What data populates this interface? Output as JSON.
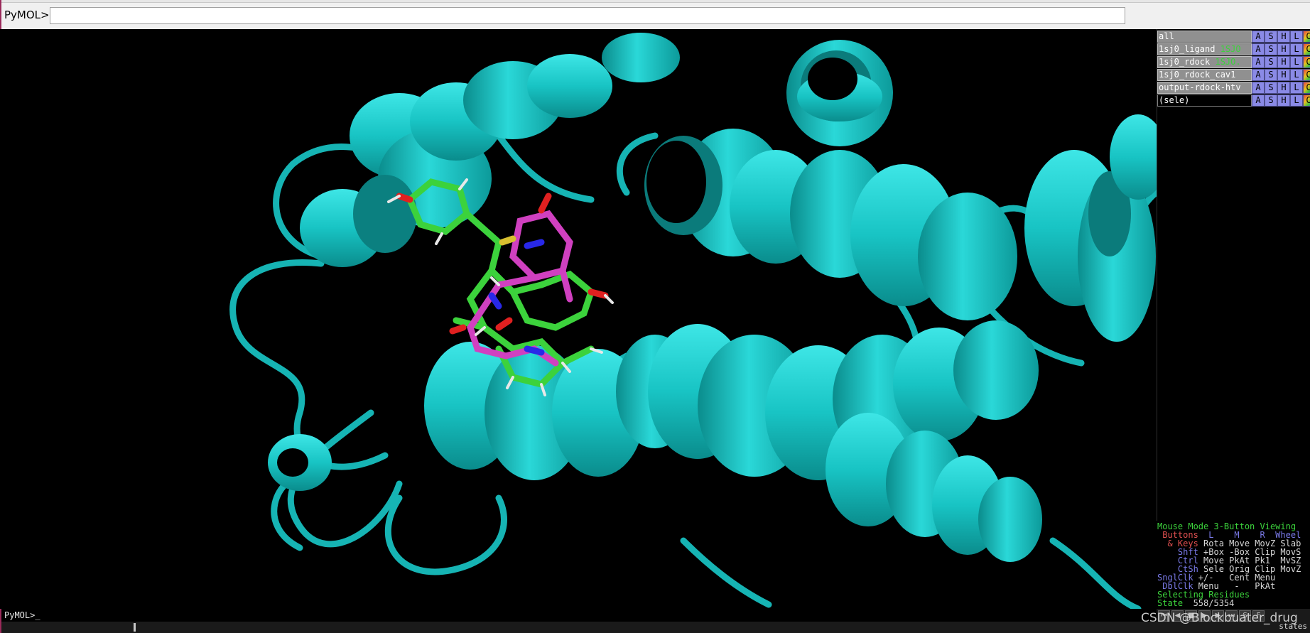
{
  "top": {
    "prompt": "PyMOL>",
    "input_value": ""
  },
  "objects": [
    {
      "name": "all",
      "tag": ""
    },
    {
      "name": "1sj0_ligand",
      "tag": "1SJO"
    },
    {
      "name": "1sj0_rdock",
      "tag": "1SJO."
    },
    {
      "name": "1sj0_rdock_cav1",
      "tag": ""
    },
    {
      "name": "output-rdock-htv",
      "tag": ""
    },
    {
      "name": "(sele)",
      "tag": ""
    }
  ],
  "object_buttons": [
    "A",
    "S",
    "H",
    "L",
    "C"
  ],
  "mouse": {
    "mode": "Mouse Mode 3-Button Viewing",
    "buttons_label": " Buttons",
    "buttons_cols": "  L    M    R  Wheel",
    "keys_label": "  & Keys",
    "keys_vals": " Rota Move MovZ Slab",
    "shft_label": "    Shft",
    "shft_vals": " +Box -Box Clip MovS",
    "ctrl_label": "    Ctrl",
    "ctrl_vals": " Move PkAt Pk1  MvSZ",
    "ctsh_label": "    CtSh",
    "ctsh_vals": " Sele Orig Clip MovZ",
    "snglclk_label": "SnglClk",
    "snglclk_vals": " +/-   Cent Menu",
    "dblclk_label": " DblClk",
    "dblclk_vals": " Menu   -   PkAt",
    "selecting": "Selecting Residues",
    "state_label": "State",
    "state_value": "  558/5354"
  },
  "bottom": {
    "prompt": "PyMOL>_",
    "states_label": "states"
  },
  "watermark": "CSDN @Blockbuater_drug",
  "colors": {
    "ribbon": "#1ec8c8",
    "ribbon_dark": "#0e8a8a",
    "ligand_green": "#3cd23c",
    "ligand_magenta": "#d040c0",
    "nitrogen": "#2828e8",
    "oxygen": "#e02020",
    "sulfur": "#d8c030",
    "hydrogen": "#e8e8e8"
  },
  "icons": [
    "rewind-icon",
    "step-back-icon",
    "stop-icon",
    "play-icon",
    "step-forward-icon",
    "fast-forward-icon",
    "scene-icon",
    "full-screen-icon"
  ]
}
